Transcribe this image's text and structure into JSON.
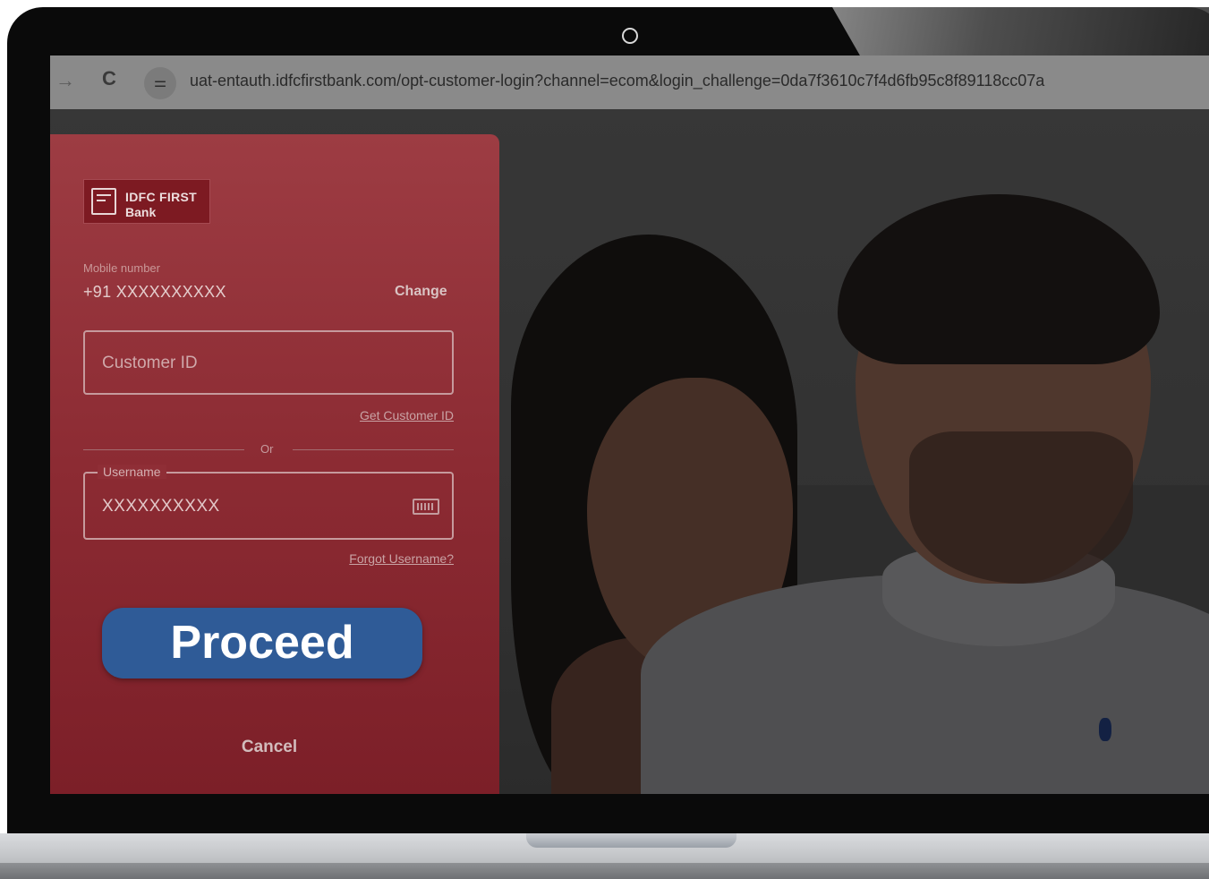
{
  "browser": {
    "url": "uat-entauth.idfcfirstbank.com/opt-customer-login?channel=ecom&login_challenge=0da7f3610c7f4d6fb95c8f89118cc07a",
    "forward_icon": "→",
    "reload_icon": "C",
    "site_settings_icon": "⚌"
  },
  "brand": {
    "line1": "IDFC FIRST",
    "line2": "Bank"
  },
  "login": {
    "mobile_label": "Mobile number",
    "mobile_value": "+91  XXXXXXXXXX",
    "change_label": "Change",
    "customer_id_placeholder": "Customer ID",
    "get_customer_id_label": "Get Customer ID",
    "or_label": "Or",
    "username_label": "Username",
    "username_value": "XXXXXXXXXX",
    "forgot_username_label": "Forgot Username?",
    "proceed_label": "Proceed",
    "cancel_label": "Cancel"
  },
  "colors": {
    "panel": "#8c2b33",
    "proceed_button": "#2f5b97"
  }
}
